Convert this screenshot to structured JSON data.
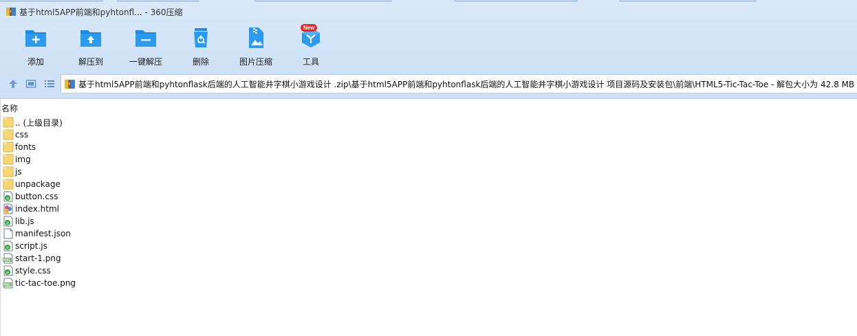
{
  "window": {
    "title": "基于html5APP前端和pyhtonfl... - 360压缩"
  },
  "toolbar": {
    "add_label": "添加",
    "extract_to_label": "解压到",
    "one_click_extract_label": "一键解压",
    "delete_label": "删除",
    "image_compress_label": "图片压缩",
    "tools_label": "工具",
    "tools_badge": "New"
  },
  "address": {
    "path": "基于html5APP前端和pyhtonflask后端的人工智能井字棋小游戏设计 .zip\\基于html5APP前端和pyhtonflask后端的人工智能井字棋小游戏设计 项目源码及安装包\\前端\\HTML5-Tic-Tac-Toe - 解包大小为 42.8 MB"
  },
  "list": {
    "column_name": "名称",
    "items": [
      {
        "name": ".. (上级目录)",
        "type": "folder"
      },
      {
        "name": "css",
        "type": "folder"
      },
      {
        "name": "fonts",
        "type": "folder"
      },
      {
        "name": "img",
        "type": "folder"
      },
      {
        "name": "js",
        "type": "folder"
      },
      {
        "name": "unpackage",
        "type": "folder"
      },
      {
        "name": "button.css",
        "type": "script"
      },
      {
        "name": "index.html",
        "type": "html"
      },
      {
        "name": "lib.js",
        "type": "script"
      },
      {
        "name": "manifest.json",
        "type": "doc"
      },
      {
        "name": "script.js",
        "type": "script"
      },
      {
        "name": "start-1.png",
        "type": "png"
      },
      {
        "name": "style.css",
        "type": "script"
      },
      {
        "name": "tic-tac-toe.png",
        "type": "png"
      }
    ]
  },
  "colors": {
    "accent": "#1e8ce6",
    "toolbar_bg": "#d5e6f8",
    "folder": "#f7d774",
    "badge": "#e8282b"
  }
}
